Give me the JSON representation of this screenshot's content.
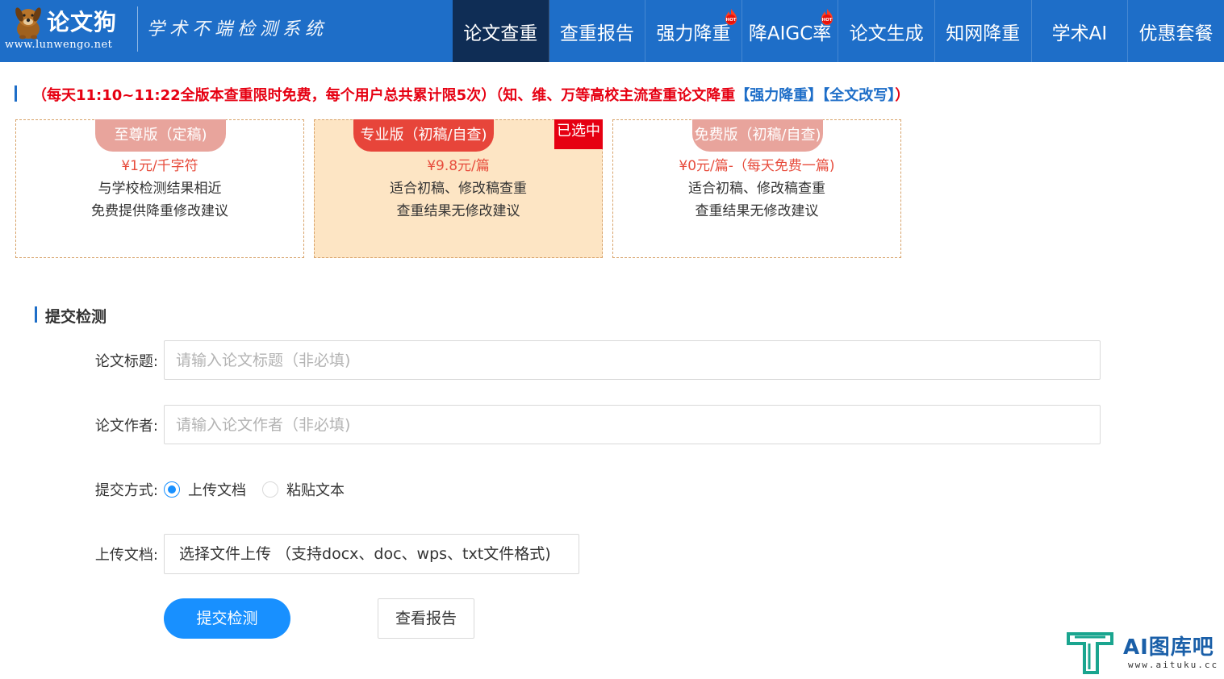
{
  "header": {
    "brand_name": "论文狗",
    "brand_url": "www.lunwengo.net",
    "slogan": "学术不端检测系统",
    "nav": [
      {
        "label": "论文查重",
        "active": true,
        "hot": false
      },
      {
        "label": "查重报告",
        "active": false,
        "hot": false
      },
      {
        "label": "强力降重",
        "active": false,
        "hot": true
      },
      {
        "label": "降AIGC率",
        "active": false,
        "hot": true
      },
      {
        "label": "论文生成",
        "active": false,
        "hot": false
      },
      {
        "label": "知网降重",
        "active": false,
        "hot": false
      },
      {
        "label": "学术AI",
        "active": false,
        "hot": false
      },
      {
        "label": "优惠套餐",
        "active": false,
        "hot": false
      }
    ],
    "hot_badge": "HOT"
  },
  "notice": {
    "part1": "（每天11:10~11:22全版本查重限时免费，每个用户总共累计限5次）（知、维、万等高校主流查重论文降重",
    "link1": "【强力降重】",
    "link2": "【全文改写】",
    "part2": "）"
  },
  "plans": [
    {
      "tag": "至尊版（定稿)",
      "price": "¥1元/千字符",
      "desc1": "与学校检测结果相近",
      "desc2": "免费提供降重修改建议"
    },
    {
      "tag": "专业版（初稿/自查)",
      "price": "¥9.8元/篇",
      "desc1": "适合初稿、修改稿查重",
      "desc2": "查重结果无修改建议",
      "badge": "已选中"
    },
    {
      "tag": "免费版（初稿/自查)",
      "price": "¥0元/篇-（每天免费一篇)",
      "desc1": "适合初稿、修改稿查重",
      "desc2": "查重结果无修改建议"
    }
  ],
  "form": {
    "section_title": "提交检测",
    "title_label": "论文标题:",
    "title_placeholder": "请输入论文标题（非必填)",
    "author_label": "论文作者:",
    "author_placeholder": "请输入论文作者（非必填)",
    "method_label": "提交方式:",
    "method_options": [
      {
        "label": "上传文档",
        "selected": true
      },
      {
        "label": "粘贴文本",
        "selected": false
      }
    ],
    "upload_label": "上传文档:",
    "upload_button": "选择文件上传 （支持docx、doc、wps、txt文件格式)",
    "submit_button": "提交检测",
    "report_button": "查看报告"
  },
  "watermark": {
    "name": "AI图库吧",
    "url": "www.aituku.cc"
  },
  "colors": {
    "header_bg": "#1e6ec8",
    "nav_active_bg": "#0f2d55",
    "accent_red": "#e60012",
    "primary_blue": "#1890ff",
    "plan_selected_bg": "#fde5c4"
  }
}
